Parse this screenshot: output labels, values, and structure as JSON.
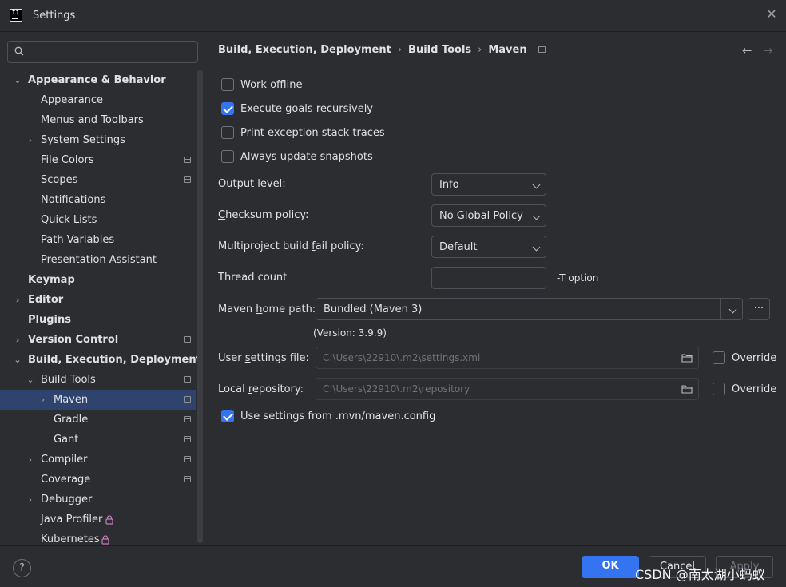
{
  "window": {
    "title": "Settings",
    "app_icon_text": "IJ"
  },
  "sidebar": {
    "search_placeholder": "",
    "items": [
      {
        "label": "Appearance & Behavior",
        "expanded": true
      },
      {
        "label": "Appearance"
      },
      {
        "label": "Menus and Toolbars"
      },
      {
        "label": "System Settings"
      },
      {
        "label": "File Colors"
      },
      {
        "label": "Scopes"
      },
      {
        "label": "Notifications"
      },
      {
        "label": "Quick Lists"
      },
      {
        "label": "Path Variables"
      },
      {
        "label": "Presentation Assistant"
      },
      {
        "label": "Keymap"
      },
      {
        "label": "Editor"
      },
      {
        "label": "Plugins"
      },
      {
        "label": "Version Control"
      },
      {
        "label": "Build, Execution, Deployment",
        "expanded": true
      },
      {
        "label": "Build Tools",
        "expanded": true
      },
      {
        "label": "Maven",
        "selected": true
      },
      {
        "label": "Gradle"
      },
      {
        "label": "Gant"
      },
      {
        "label": "Compiler"
      },
      {
        "label": "Coverage"
      },
      {
        "label": "Debugger"
      },
      {
        "label": "Java Profiler"
      },
      {
        "label": "Kubernetes"
      }
    ]
  },
  "breadcrumb": {
    "items": [
      "Build, Execution, Deployment",
      "Build Tools",
      "Maven"
    ],
    "separator": "›"
  },
  "nav": {
    "back": "←",
    "forward": "→"
  },
  "options": {
    "work_offline": {
      "label_pre": "Work ",
      "label_ul": "o",
      "label_post": "ffline",
      "checked": false
    },
    "execute_goals": {
      "label_pre": "Execute ",
      "label_ul": "g",
      "label_post": "oals recursively",
      "checked": true
    },
    "print_exception": {
      "label_pre": "Print ",
      "label_ul": "e",
      "label_post": "xception stack traces",
      "checked": false
    },
    "always_update": {
      "label_pre": "Always update ",
      "label_ul": "s",
      "label_post": "napshots",
      "checked": false
    },
    "output_level": {
      "label_pre": "Output ",
      "label_ul": "l",
      "label_post": "evel:",
      "value": "Info"
    },
    "checksum_policy": {
      "label_pre": "",
      "label_ul": "C",
      "label_post": "hecksum policy:",
      "value": "No Global Policy"
    },
    "fail_policy": {
      "label_pre": "Multiproject build ",
      "label_ul": "f",
      "label_post": "ail policy:",
      "value": "Default"
    },
    "thread_count": {
      "label": "Thread count",
      "value": "",
      "suffix": "-T option"
    },
    "maven_home": {
      "label_pre": "Maven ",
      "label_ul": "h",
      "label_post": "ome path:",
      "value": "Bundled (Maven 3)",
      "browse": "...",
      "version": "(Version: 3.9.9)"
    },
    "user_settings": {
      "label_pre": "User ",
      "label_ul": "s",
      "label_post": "ettings file:",
      "value": "C:\\Users\\22910\\.m2\\settings.xml",
      "override": "Override",
      "override_checked": false
    },
    "local_repo": {
      "label_pre": "Local ",
      "label_ul": "r",
      "label_post": "epository:",
      "value": "C:\\Users\\22910\\.m2\\repository",
      "override": "Override",
      "override_checked": false
    },
    "use_mvn_config": {
      "label": "Use settings from .mvn/maven.config",
      "checked": true
    }
  },
  "footer": {
    "help": "?",
    "ok": "OK",
    "cancel": "Cancel",
    "apply": "Apply",
    "watermark": "CSDN @南太湖小蚂蚁"
  },
  "colors": {
    "accent": "#3574f0",
    "selection": "#2e436e",
    "background": "#2b2d30",
    "text": "#dfe1e5",
    "profiler_lock": "#c77dbb"
  },
  "icons": [
    "search-icon",
    "close-icon",
    "chevron-right-icon",
    "chevron-down-icon",
    "lock-icon",
    "folder-icon",
    "back-arrow-icon",
    "forward-arrow-icon",
    "help-icon"
  ]
}
